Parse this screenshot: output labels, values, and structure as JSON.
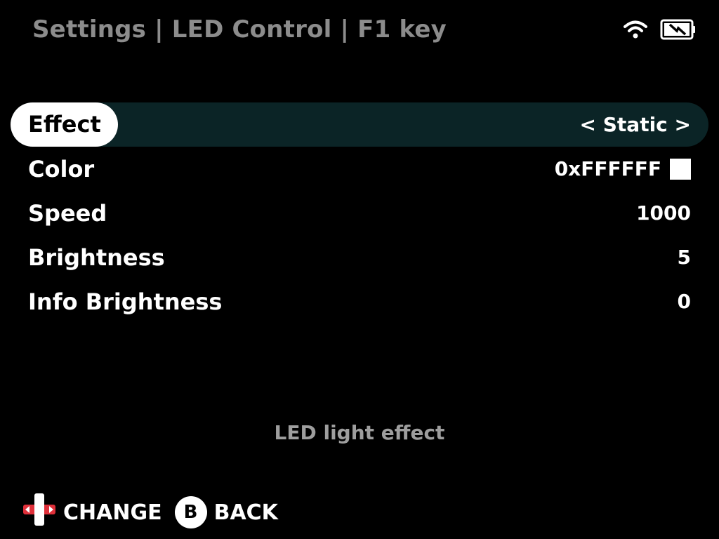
{
  "header": {
    "title": "Settings | LED Control | F1 key"
  },
  "status": {
    "wifi_icon": "wifi-icon",
    "battery_icon": "battery-charging-icon"
  },
  "menu": {
    "items": [
      {
        "label": "Effect",
        "value": "< Static >",
        "selected": true
      },
      {
        "label": "Color",
        "value": "0xFFFFFF",
        "swatch_color": "#FFFFFF"
      },
      {
        "label": "Speed",
        "value": "1000"
      },
      {
        "label": "Brightness",
        "value": "5"
      },
      {
        "label": "Info Brightness",
        "value": "0"
      }
    ]
  },
  "hint": {
    "text": "LED light effect"
  },
  "footer": {
    "change_label": "CHANGE",
    "change_icon": "dpad-icon",
    "back_button": "B",
    "back_label": "BACK"
  },
  "colors": {
    "background": "#000000",
    "selected_row_bg": "#0B2426",
    "header_text": "#8C8C8C",
    "dpad_accent": "#E0303A"
  }
}
